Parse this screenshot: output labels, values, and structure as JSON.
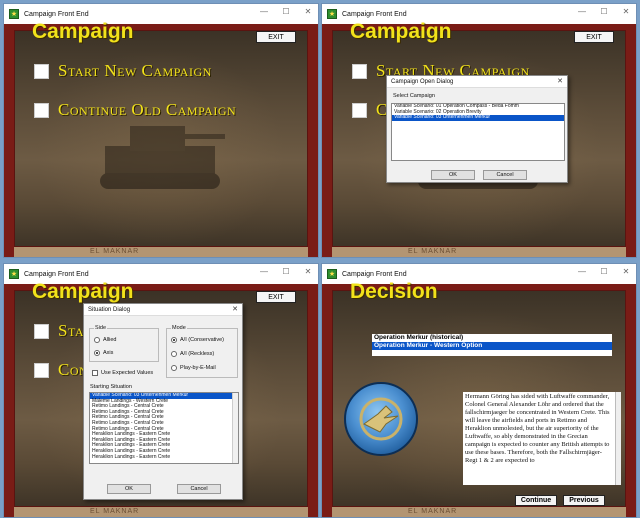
{
  "window": {
    "title": "Campaign Front End",
    "minimize_glyph": "—",
    "maximize_glyph": "☐",
    "close_glyph": "✕"
  },
  "campaign": {
    "heading": "Campaign",
    "exit_label": "EXIT",
    "start_new": "Start New Campaign",
    "continue_old": "Continue Old Campaign",
    "map_label": "EL MAKNAR"
  },
  "open_dialog": {
    "title": "Campaign Open Dialog",
    "list_label": "Select Campaign",
    "items": [
      "Variable Scenario: 01 Operation Compass - Beda Fomm",
      "Variable Scenario: 02 Operation Brevity",
      "Variable Scenario: 03 Unternehmen Merkur"
    ],
    "selected_index": 2,
    "ok_label": "OK",
    "cancel_label": "Cancel"
  },
  "situation_dialog": {
    "title": "Situation Dialog",
    "side_label": "Side",
    "side_options": [
      "Allied",
      "Axis"
    ],
    "side_selected": "Axis",
    "mode_label": "Mode",
    "mode_options": [
      "A/I (Conservative)",
      "A/I (Reckless)",
      "Play-by-E-Mail"
    ],
    "mode_selected": "A/I (Conservative)",
    "expected_values_label": "Use Expected Values",
    "starting_label": "Starting Situation",
    "situations": [
      "Variable Scenario: 03 Unternehmen Merkur",
      "Maleme Landings - Western Crete",
      "Retimo Landings - Central Crete",
      "Retimo Landings - Central Crete",
      "Retimo Landings - Central Crete",
      "Retimo Landings - Central Crete",
      "Retimo Landings - Central Crete",
      "Heraklion Landings - Eastern Crete",
      "Heraklion Landings - Eastern Crete",
      "Heraklion Landings - Eastern Crete",
      "Heraklion Landings - Eastern Crete",
      "Heraklion Landings - Eastern Crete"
    ],
    "situation_selected": 0,
    "ok_label": "OK",
    "cancel_label": "Cancel"
  },
  "decision": {
    "heading": "Decision",
    "options": [
      "Operation Merkur (historical)",
      "Operation Merkur - Western Option"
    ],
    "selected_index": 1,
    "body": "Hermann Göring has sided with Luftwaffe commander, Colonel General Alexander Löhr and ordered that the fallschirmjaeger be concentrated in Western Crete. This will leave the airfields and ports in Retimo and Heraklion unmolested, but the air superiority of the Luftwaffe, so ably demonstrated in the Grecian campaign is expected to counter any British attempts to use these bases. Therefore, both the Fallschirmjäger-Regt 1 & 2 are expected to",
    "continue_label": "Continue",
    "previous_label": "Previous",
    "map_label": "EL MAKNAR"
  },
  "colors": {
    "heading_yellow": "#f2e21a",
    "frame_red": "#7a1c16",
    "selection_blue": "#0a55c8"
  }
}
